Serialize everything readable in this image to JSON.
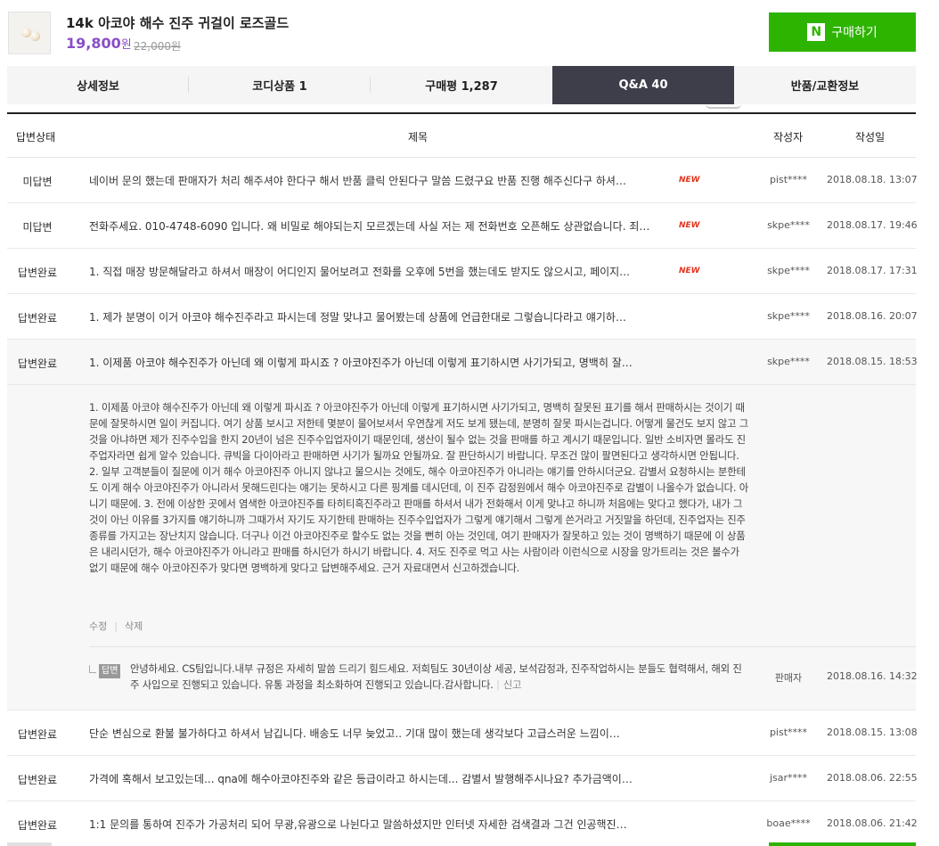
{
  "product": {
    "title": "14k 아코야 해수 진주 귀걸이 로즈골드",
    "price": "19,800",
    "price_unit": "원",
    "original_price": "22,000원",
    "buy_label": "구매하기",
    "buy_icon_letter": "N",
    "accent_color": "#2db400",
    "price_color": "#8a4fc7"
  },
  "tabs": [
    {
      "label": "상세정보"
    },
    {
      "label": "코디상품 1"
    },
    {
      "label": "구매평 1,287"
    },
    {
      "label": "Q&A 40"
    },
    {
      "label": "반품/교환정보"
    }
  ],
  "table": {
    "headers": {
      "status": "답변상태",
      "title": "제목",
      "author": "작성자",
      "date": "작성일"
    },
    "rows_top": [
      {
        "status": "미답변",
        "title": "네이버 문의 했는데 판매자가 처리 해주셔야 한다구 해서 반품 클릭 안된다구 말씀 드렸구요 반품 진행 해주신다구 하셔…",
        "new": "NEW",
        "author": "pist****",
        "date": "2018.08.18. 13:07"
      },
      {
        "status": "미답변",
        "title": "전화주세요. 010-4748-6090 입니다. 왜 비밀로 해야되는지 모르겠는데 사실 저는 제 전화번호 오픈해도 상관없습니다. 죄…",
        "new": "NEW",
        "author": "skpe****",
        "date": "2018.08.17. 19:46"
      },
      {
        "status": "답변완료",
        "title": "1. 직접 매장 방문해달라고 하셔서 매장이 어디인지 물어보려고 전화를 오후에 5번을 했는데도 받지도 않으시고, 페이지…",
        "new": "NEW",
        "author": "skpe****",
        "date": "2018.08.17. 17:31"
      },
      {
        "status": "답변완료",
        "title": "1. 제가 분명이 이거 아코야 해수진주라고 파시는데 정말 맞냐고 물어봤는데 상품에 언급한대로 그렇습니다라고 얘기하…",
        "new": "",
        "author": "skpe****",
        "date": "2018.08.16. 20:07"
      },
      {
        "status": "답변완료",
        "title": "1. 이제품 아코야 해수진주가 아닌데 왜 이렇게 파시죠 ? 아코야진주가 아닌데 이렇게 표기하시면 사기가되고, 명백히 잘…",
        "new": "",
        "author": "skpe****",
        "date": "2018.08.15. 18:53"
      }
    ],
    "detail": {
      "body": "1. 이제품 아코야 해수진주가 아닌데 왜 이렇게 파시죠 ? 아코야진주가 아닌데 이렇게 표기하시면 사기가되고, 명백히 잘못된 표기를 해서 판매하시는 것이기 때문에 잘못하시면 일이 커집니다. 여기 상품 보시고 저한테 몇분이 물어보셔서 우연찮게 저도 보게 됐는데, 분명히 잘못 파시는겁니다. 어떻게 물건도 보지 않고 그것을 아냐하면 제가 진주수입을 한지 20년이 넘은 진주수입업자이기 때문인데, 생산이 될수 없는 것을 판매를 하고 계시기 때문입니다. 일반 소비자면 몰라도 진주업자라면 쉽게 알수 있습니다. 큐빅을 다이아라고 판매하면 사기가 될까요 안될까요. 잘 판단하시기 바랍니다. 무조건 많이 팔면된다고 생각하시면 안됩니다. 2. 일부 고객분들이 질문에 이거 해수 아코야진주 아니지 않냐고 물으시는 것에도, 해수 아코야진주가 아니라는 얘기를 안하시더군요. 감별서 요청하시는 분한테도 이게 해수 아코야진주가 아니라서 못해드린다는 얘기는 못하시고 다른 핑계를 데시던데, 이 진주 감정원에서 해수 아코야진주로 감별이 나올수가 없습니다. 아니기 때문에. 3. 전에 이상한 곳에서 염색한 아코야진주를 타히티흑진주라고 판매를 하셔서 내가 전화해서 이게 맞냐고 하니까 처음에는 맞다고 했다가, 내가 그것이 아닌 이유를 3가지를 얘기하니까 그때가서 자기도 자기한테 판매하는 진주수입업자가 그렇게 얘기해서 그렇게 쓴거라고 거짓말을 하던데, 진주업자는 진주종류를 가지고는 장난치지 않습니다. 더구나 이건 아코야진주로 할수도 없는 것을 뻔히 아는 것인데, 여기 판매자가 잘못하고 있는 것이 명백하기 때문에 이 상품은 내리시던가, 해수 아코야진주가 아니라고 판매를 하시던가 하시기 바랍니다. 4. 저도 진주로 먹고 사는 사람이라 이런식으로 시장을 망가트리는 것은 볼수가 없기 때문에 해수 아코야진주가 맞다면 명백하게 맞다고 답변해주세요. 근거 자료대면서 신고하겠습니다.",
      "edit_label": "수정",
      "delete_label": "삭제",
      "answer_badge": "답변",
      "answer_text": "안녕하세요. CS팀입니다.내부 규정은 자세히 말씀 드리기 힘드세요. 저희팀도 30년이상 세공, 보석감정과, 진주작업하시는 분들도 협력해서, 해외 진주 사입으로 진행되고 있습니다. 유통 과정을 최소화하여 진행되고 있습니다.감사합니다.",
      "report_label": "신고",
      "answer_author": "판매자",
      "answer_date": "2018.08.16. 14:32"
    },
    "rows_bottom": [
      {
        "status": "답변완료",
        "title": "단순 변심으로 환불 불가하다고 하셔서 남깁니다. 배송도 너무 늦었고.. 기대 많이 했는데 생각보다 고급스러운 느낌이…",
        "author": "pist****",
        "date": "2018.08.15. 13:08"
      },
      {
        "status": "답변완료",
        "title": "가격에 혹해서 보고있는데... qna에 해수아코야진주와 같은 등급이라고 하시는데... 감별서 발행해주시나요? 추가금액이…",
        "author": "jsar****",
        "date": "2018.08.06. 22:55"
      },
      {
        "status": "답변완료",
        "title": "1:1 문의를 통하여 진주가 가공처리 되어 무광,유광으로 나뉜다고 말씀하셨지만 인터넷 자세한 검색결과 그건 인공핵진…",
        "author": "boae****",
        "date": "2018.08.06. 21:42"
      }
    ]
  }
}
